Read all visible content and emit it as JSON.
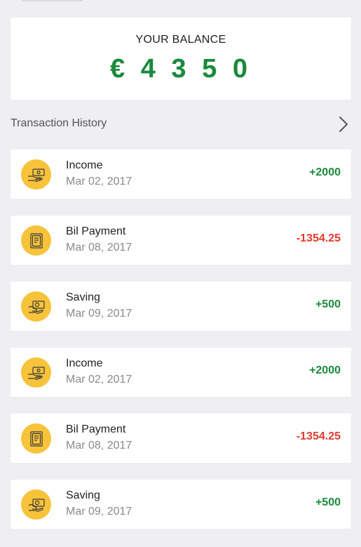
{
  "balance": {
    "label": "YOUR BALANCE",
    "amount": "€ 4 3 5 0"
  },
  "history": {
    "title": "Transaction History",
    "arrow_icon": "chevron-right-icon"
  },
  "colors": {
    "positive": "#1a8a3c",
    "negative": "#e5392c",
    "icon_bg": "#f7c33a",
    "background": "#eeeef3"
  },
  "transactions": [
    {
      "name": "Income",
      "date": "Mar 02, 2017",
      "amount": "+2000",
      "type": "income",
      "icon": "money-hand-icon"
    },
    {
      "name": "Bil Payment",
      "date": "Mar 08, 2017",
      "amount": "-1354.25",
      "type": "bill",
      "icon": "receipt-icon"
    },
    {
      "name": "Saving",
      "date": "Mar 09, 2017",
      "amount": "+500",
      "type": "saving",
      "icon": "saving-hand-icon"
    },
    {
      "name": "Income",
      "date": "Mar 02, 2017",
      "amount": "+2000",
      "type": "income",
      "icon": "money-hand-icon"
    },
    {
      "name": "Bil Payment",
      "date": "Mar 08, 2017",
      "amount": "-1354.25",
      "type": "bill",
      "icon": "receipt-icon"
    },
    {
      "name": "Saving",
      "date": "Mar 09, 2017",
      "amount": "+500",
      "type": "saving",
      "icon": "saving-hand-icon"
    }
  ]
}
